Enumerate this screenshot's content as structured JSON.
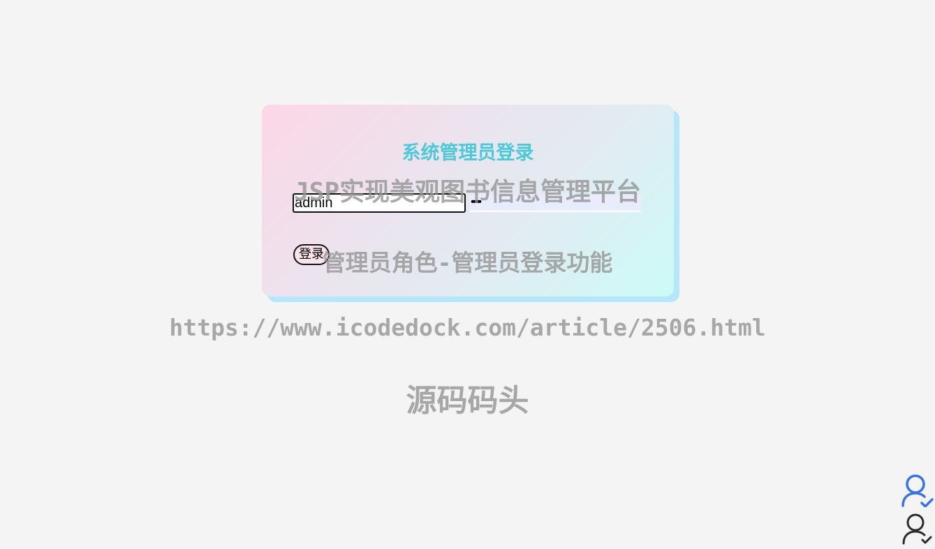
{
  "login": {
    "title": "系统管理员登录",
    "username_value": "admin",
    "password_value": "•••••",
    "button_label": "登录"
  },
  "watermarks": {
    "platform": "JSP实现美观图书信息管理平台",
    "feature": "管理员角色-管理员登录功能",
    "url": "https://www.icodedock.com/article/2506.html",
    "site": "源码码头"
  },
  "icons": {
    "top": "user-check-icon",
    "bottom": "user-check-icon"
  },
  "colors": {
    "title": "#4cc8d8",
    "user_icon_blue": "#3b73e0",
    "user_icon_dark": "#2b2b2b"
  }
}
